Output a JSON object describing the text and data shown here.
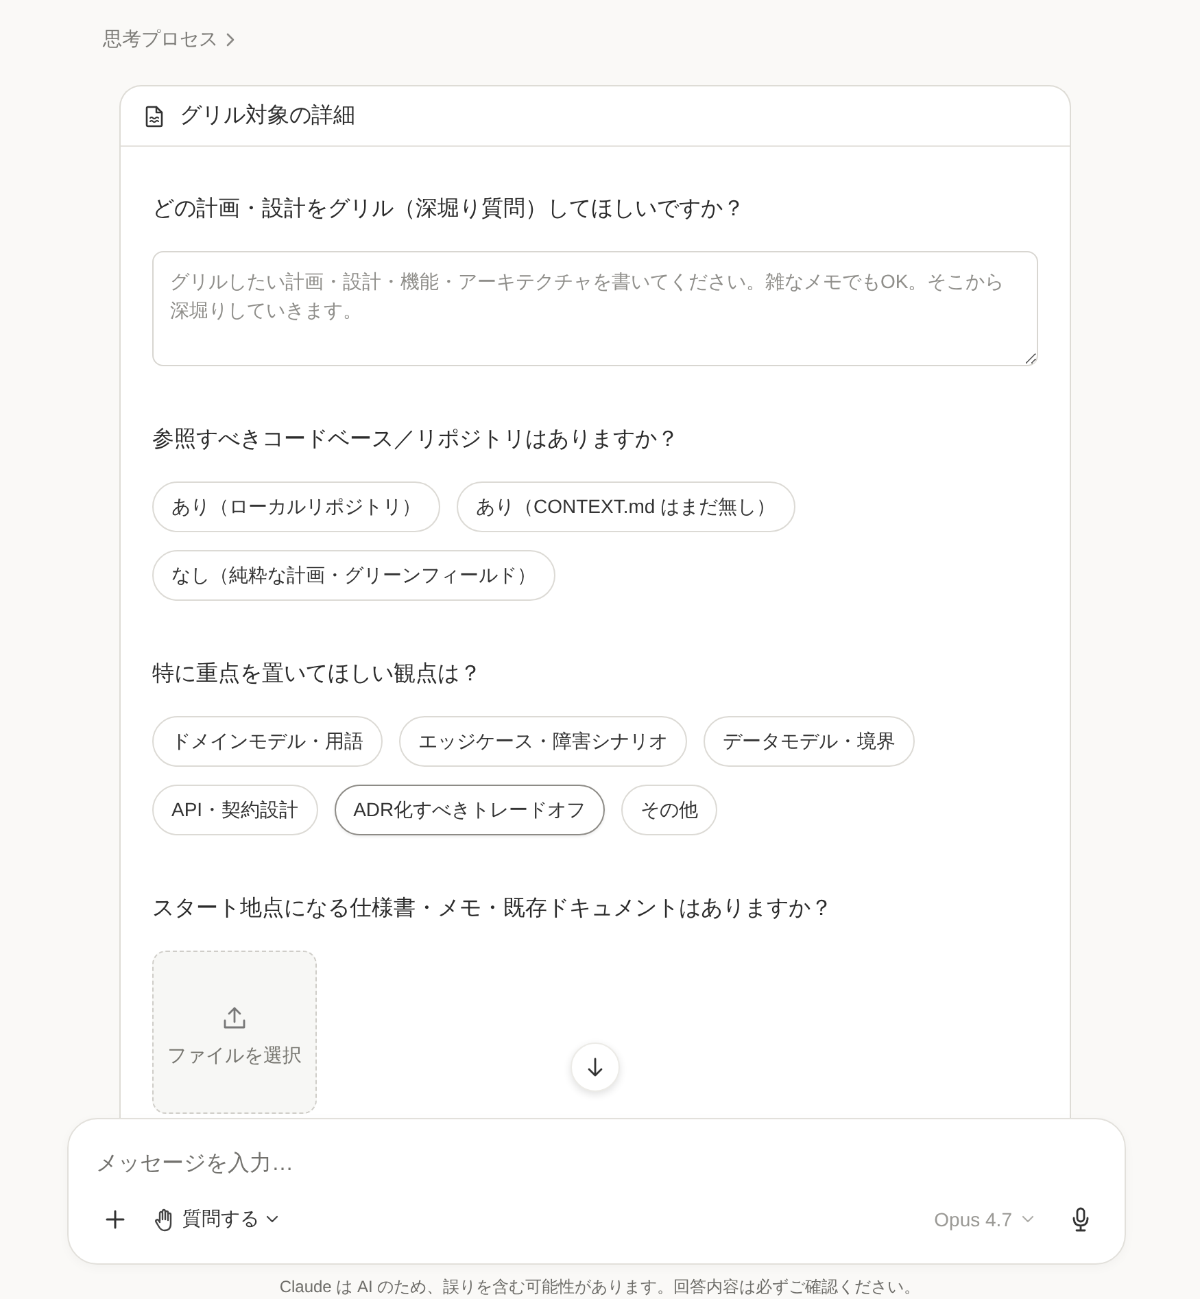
{
  "breadcrumb": {
    "label": "思考プロセス"
  },
  "card": {
    "title": "グリル対象の詳細",
    "questions": [
      {
        "kind": "text",
        "prompt": "どの計画・設計をグリル（深堀り質問）してほしいですか？",
        "placeholder": "グリルしたい計画・設計・機能・アーキテクチャを書いてください。雑なメモでもOK。そこから深堀りしていきます。"
      },
      {
        "kind": "choices",
        "prompt": "参照すべきコードベース／リポジトリはありますか？",
        "options": [
          {
            "label": "あり（ローカルリポジトリ）",
            "selected": false
          },
          {
            "label": "あり（CONTEXT.md はまだ無し）",
            "selected": false
          },
          {
            "label": "なし（純粋な計画・グリーンフィールド）",
            "selected": false
          }
        ]
      },
      {
        "kind": "choices",
        "prompt": "特に重点を置いてほしい観点は？",
        "options": [
          {
            "label": "ドメインモデル・用語",
            "selected": false
          },
          {
            "label": "エッジケース・障害シナリオ",
            "selected": false
          },
          {
            "label": "データモデル・境界",
            "selected": false
          },
          {
            "label": "API・契約設計",
            "selected": false
          },
          {
            "label": "ADR化すべきトレードオフ",
            "selected": true
          },
          {
            "label": "その他",
            "selected": false
          }
        ]
      },
      {
        "kind": "file",
        "prompt": "スタート地点になる仕様書・メモ・既存ドキュメントはありますか？",
        "button_label": "ファイルを選択"
      }
    ]
  },
  "composer": {
    "placeholder": "メッセージを入力…",
    "mode": "質問する",
    "model": "Opus 4.7"
  },
  "disclaimer": "Claude は AI のため、誤りを含む可能性があります。回答内容は必ずご確認ください。"
}
